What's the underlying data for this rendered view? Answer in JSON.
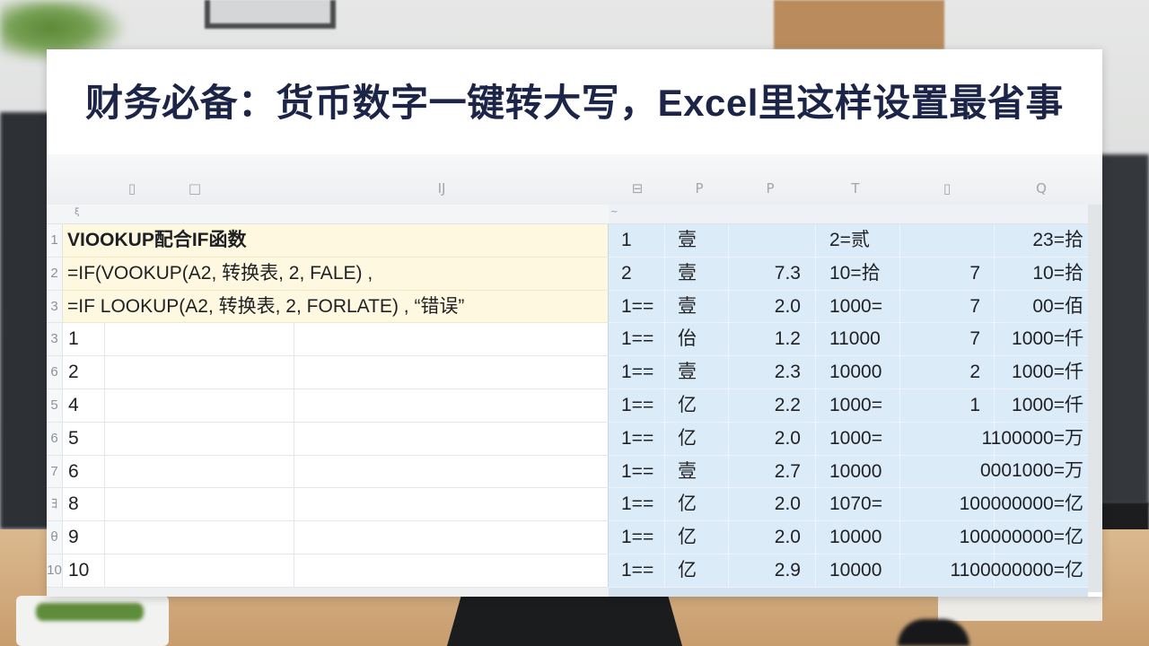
{
  "title": "财务必备：货币数字一键转大写，Excel里这样设置最省事",
  "column_header_icons": [
    {
      "icon": "bar-glyph-icon",
      "glyph": "▯"
    },
    {
      "icon": "square-glyph-icon",
      "glyph": "□"
    },
    {
      "icon": "bracket-glyph-icon",
      "glyph": "IJ"
    },
    {
      "icon": "boxed-minus-glyph-icon",
      "glyph": "⊟"
    },
    {
      "icon": "p-glyph-icon",
      "glyph": "P"
    },
    {
      "icon": "flag-glyph-icon",
      "glyph": "P"
    },
    {
      "icon": "t-glyph-icon",
      "glyph": "T"
    },
    {
      "icon": "bar-glyph-icon",
      "glyph": "▯"
    },
    {
      "icon": "q-glyph-icon",
      "glyph": "Q"
    }
  ],
  "subheader_marks": {
    "left": "ξ",
    "right": "~"
  },
  "rows": [
    {
      "label": "1",
      "left": "VIOOKUP配合IF函数",
      "cells": [
        "1",
        "壹",
        "",
        "2=贰",
        "",
        "23=拾"
      ]
    },
    {
      "label": "2",
      "left": "=IF(VOOKUP(A2, 转换表, 2, FALE) ,",
      "cells": [
        "2",
        "壹",
        "7.3",
        "10=拾",
        "7",
        "10=拾"
      ]
    },
    {
      "label": "3",
      "left": "=IF LOOKUP(A2, 转换表, 2, FORLATE) , “错误”",
      "cells": [
        "1==",
        "壹",
        "2.0",
        "1000=",
        "7",
        "00=佰"
      ]
    },
    {
      "label": "3",
      "left": "1",
      "cells": [
        "1==",
        "佁",
        "1.2",
        "11000",
        "7",
        "1000=仟"
      ]
    },
    {
      "label": "6",
      "left": "2",
      "cells": [
        "1==",
        "壹",
        "2.3",
        "10000",
        "2",
        "1000=仟"
      ]
    },
    {
      "label": "5",
      "left": "4",
      "cells": [
        "1==",
        "亿",
        "2.2",
        "1000=",
        "1",
        "1000=仟"
      ]
    },
    {
      "label": "6",
      "left": "5",
      "cells": [
        "1==",
        "亿",
        "2.0",
        "1000=",
        "",
        "1100000=万"
      ]
    },
    {
      "label": "7",
      "left": "6",
      "cells": [
        "1==",
        "壹",
        "2.7",
        "10000",
        "",
        "0001000=万"
      ]
    },
    {
      "label": "ﾖ",
      "left": "8",
      "cells": [
        "1==",
        "亿",
        "2.0",
        "1070=",
        "",
        "100000000=亿"
      ]
    },
    {
      "label": "θ",
      "left": "9",
      "cells": [
        "1==",
        "亿",
        "2.0",
        "10000",
        "",
        "100000000=亿"
      ]
    },
    {
      "label": "10",
      "left": "10",
      "cells": [
        "1==",
        "亿",
        "2.9",
        "10000",
        "",
        "1100000000=亿"
      ]
    }
  ],
  "colors": {
    "title": "#1c2548",
    "highlight_rows": "#fdf8df",
    "conversion_area": "#dcebf8"
  }
}
